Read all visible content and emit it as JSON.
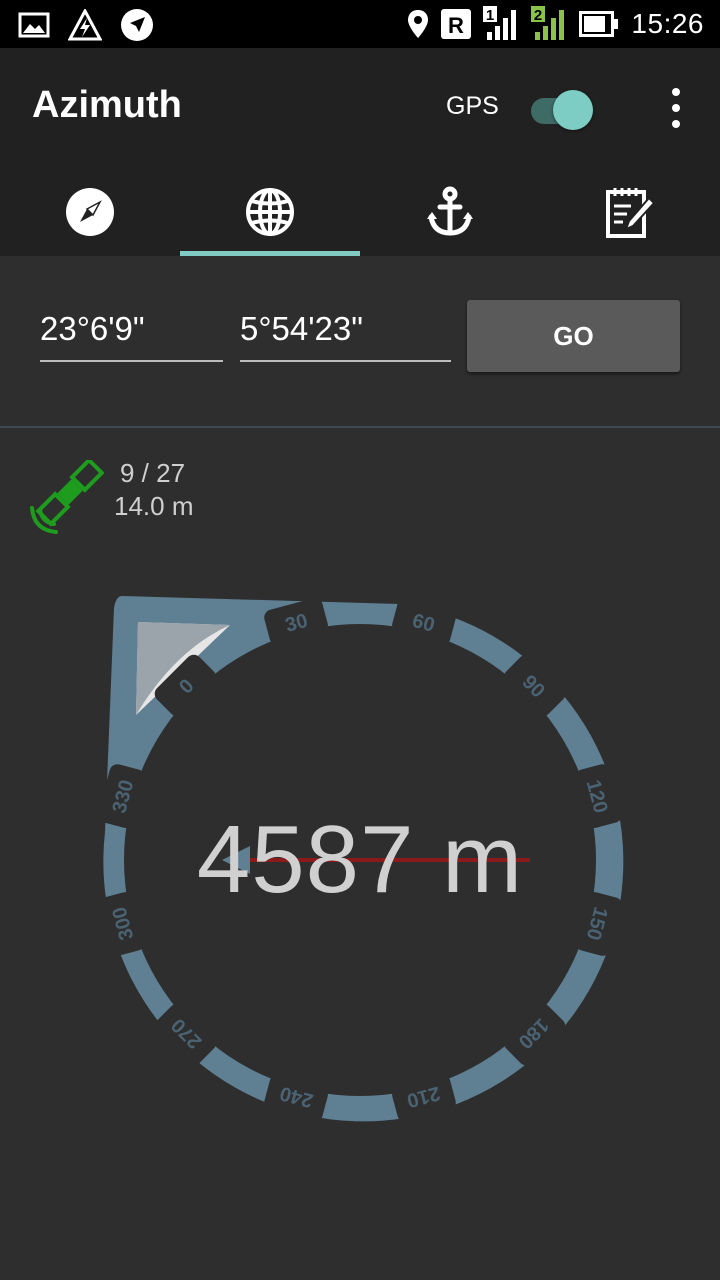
{
  "status_bar": {
    "time": "15:26",
    "left_icons": [
      "gallery-icon",
      "flash-icon",
      "navigation-icon"
    ],
    "right_icons": [
      "location-icon",
      "roaming-icon",
      "signal-sim1-icon",
      "signal-sim2-icon",
      "battery-icon"
    ],
    "sim1_badge": "1",
    "sim2_badge": "2",
    "roaming_badge": "R"
  },
  "app_bar": {
    "title": "Azimuth",
    "gps_label": "GPS",
    "gps_enabled": true
  },
  "tabs": [
    {
      "icon": "compass-icon"
    },
    {
      "icon": "globe-icon",
      "selected": true
    },
    {
      "icon": "anchor-icon"
    },
    {
      "icon": "notepad-icon"
    }
  ],
  "coordinates": {
    "latitude": "23°6'9\"",
    "longitude": "5°54'23\"",
    "go_label": "GO"
  },
  "gps_status": {
    "satellites": "9 / 27",
    "accuracy": "14.0 m"
  },
  "compass": {
    "ticks": [
      "0",
      "30",
      "60",
      "90",
      "120",
      "150",
      "180",
      "210",
      "240",
      "270",
      "300",
      "330"
    ],
    "distance": "4587 m",
    "bearing_deg": 135
  },
  "colors": {
    "accent": "#80cbc4",
    "satellite": "#1e9c1e",
    "needle": "#8b1a1a",
    "bezel": "#5f7f93"
  }
}
